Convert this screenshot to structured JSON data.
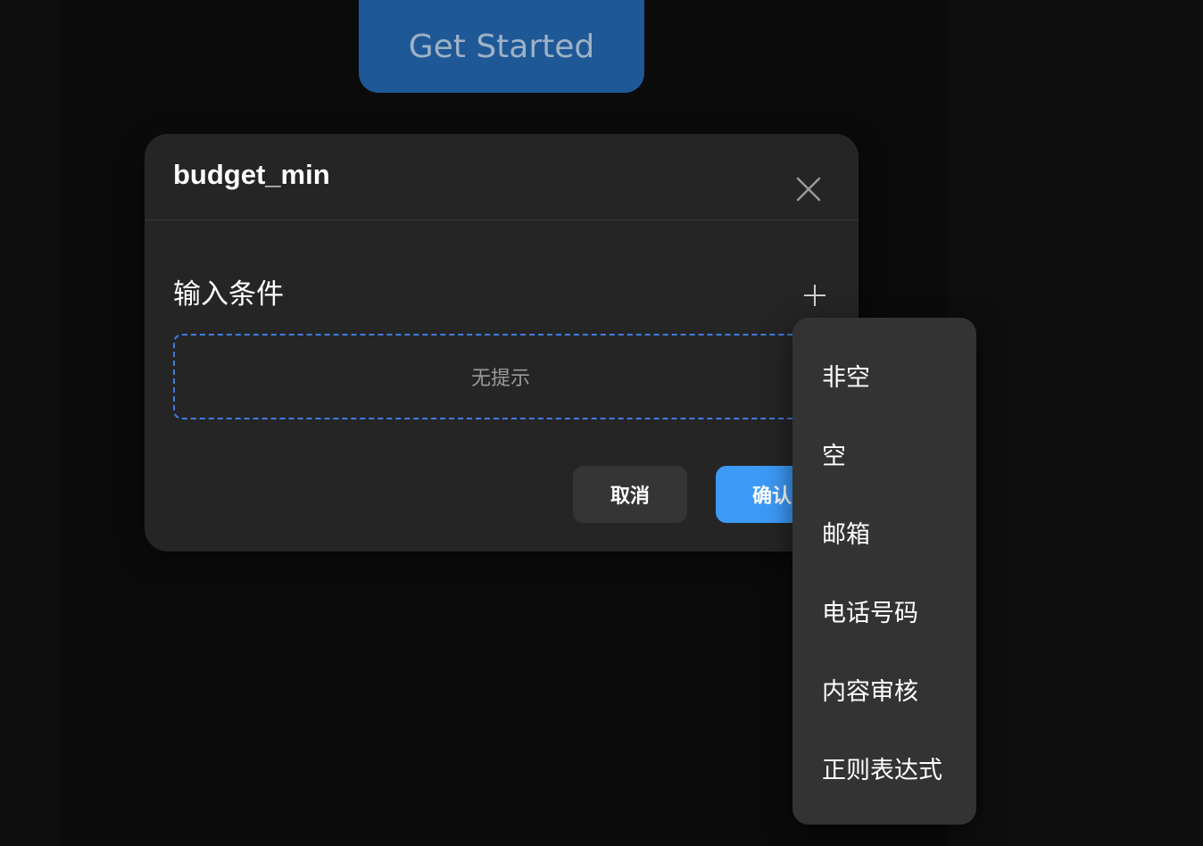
{
  "page": {
    "cta_label": "Get Started"
  },
  "modal": {
    "title": "budget_min",
    "section_label": "输入条件",
    "hint_text": "无提示",
    "cancel_label": "取消",
    "confirm_label": "确认",
    "icons": {
      "close": "close-icon",
      "add": "plus-icon"
    }
  },
  "dropdown": {
    "items": [
      {
        "label": "非空"
      },
      {
        "label": "空"
      },
      {
        "label": "邮箱"
      },
      {
        "label": "电话号码"
      },
      {
        "label": "内容审核"
      },
      {
        "label": "正则表达式"
      }
    ]
  },
  "colors": {
    "page_bg": "#0f0e0e",
    "modal_bg": "#252525",
    "dropdown_bg": "#333333",
    "cta_bg": "#1f5897",
    "confirm_bg": "#3d9af6",
    "dashed_border": "#3f7be0"
  }
}
